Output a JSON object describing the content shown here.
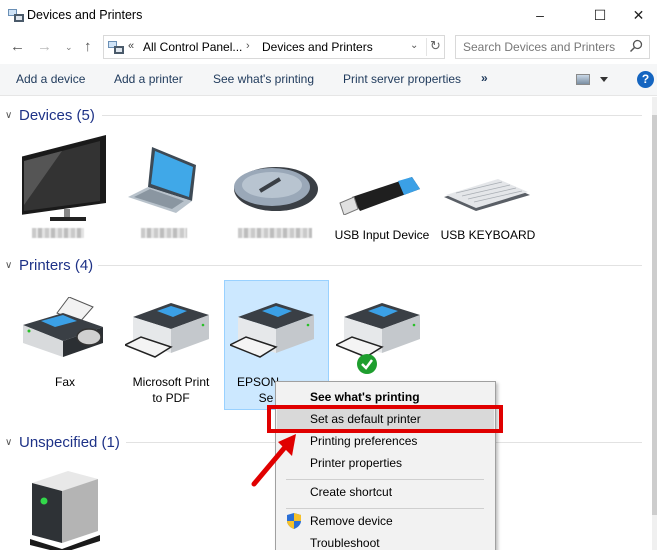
{
  "window": {
    "title": "Devices and Printers",
    "minimize": "–",
    "maximize": "☐",
    "close": "✕"
  },
  "nav": {
    "back": "←",
    "forward": "→",
    "recent": "⌄",
    "up": "↑",
    "address": {
      "overflow": "«",
      "crumbs": [
        "All Control Panel...",
        "Devices and Printers"
      ],
      "separator": "›",
      "dropdown": "⌄",
      "refresh": "↻"
    },
    "search": {
      "placeholder": "Search Devices and Printers"
    }
  },
  "commands": {
    "items": [
      "Add a device",
      "Add a printer",
      "See what's printing",
      "Print server properties"
    ],
    "more": "»",
    "help": "?"
  },
  "groups": [
    {
      "title": "Devices (5)",
      "chevron": "∨",
      "items": [
        {
          "label": "",
          "icon": "monitor-icon",
          "blurred": true
        },
        {
          "label": "",
          "icon": "laptop-icon",
          "blurred": true
        },
        {
          "label": "",
          "icon": "mouse-icon",
          "blurred": true
        },
        {
          "label": "USB Input Device",
          "icon": "usb-dongle-icon",
          "blurred": false
        },
        {
          "label": "USB KEYBOARD",
          "icon": "keyboard-icon",
          "blurred": false
        }
      ]
    },
    {
      "title": "Printers (4)",
      "chevron": "∨",
      "items": [
        {
          "label": "Fax",
          "icon": "fax-icon"
        },
        {
          "label": "Microsoft Print\nto PDF",
          "label_line1": "Microsoft Print",
          "label_line2": "to PDF",
          "icon": "printer-icon"
        },
        {
          "label_line1": "EPSON",
          "label_line2": "Se",
          "icon": "printer-icon",
          "selected": true
        },
        {
          "label": "",
          "icon": "printer-icon",
          "default": true
        }
      ]
    },
    {
      "title": "Unspecified (1)",
      "chevron": "∨",
      "items": [
        {
          "label": "",
          "icon": "generic-device-icon"
        }
      ]
    }
  ],
  "context_menu": {
    "items": [
      {
        "label": "See what's printing",
        "bold": true
      },
      {
        "label": "Set as default printer",
        "hovered": true
      },
      {
        "label": "Printing preferences"
      },
      {
        "label": "Printer properties"
      },
      {
        "label": "Create shortcut"
      },
      {
        "label": "Remove device",
        "icon": "shield-icon"
      },
      {
        "label": "Troubleshoot"
      }
    ]
  },
  "colors": {
    "accent_text": "#1e3287",
    "selection_bg": "#cce8ff",
    "annotation_red": "#e00000"
  }
}
